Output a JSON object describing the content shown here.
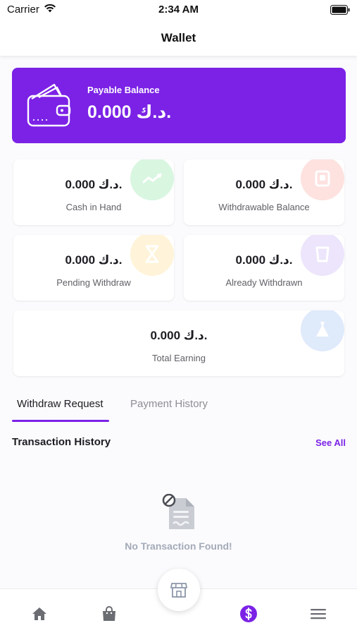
{
  "status_bar": {
    "carrier": "Carrier",
    "time": "2:34 AM"
  },
  "header": {
    "title": "Wallet"
  },
  "balance_card": {
    "label": "Payable Balance",
    "value": "0.000 د.ك."
  },
  "stats": {
    "cash_in_hand": {
      "value": "0.000 د.ك.",
      "label": "Cash in Hand"
    },
    "withdrawable_balance": {
      "value": "0.000 د.ك.",
      "label": "Withdrawable Balance"
    },
    "pending_withdraw": {
      "value": "0.000 د.ك.",
      "label": "Pending Withdraw"
    },
    "already_withdrawn": {
      "value": "0.000 د.ك.",
      "label": "Already Withdrawn"
    },
    "total_earning": {
      "value": "0.000 د.ك.",
      "label": "Total Earning"
    }
  },
  "tabs": [
    {
      "label": "Withdraw Request",
      "active": true
    },
    {
      "label": "Payment History",
      "active": false
    }
  ],
  "transactions": {
    "title": "Transaction History",
    "see_all": "See All",
    "empty_text": "No Transaction Found!"
  },
  "bottom_nav": {
    "items": [
      {
        "icon": "home-icon",
        "active": false
      },
      {
        "icon": "shopping-bag-icon",
        "active": false
      },
      {
        "icon": "store-icon",
        "active": false
      },
      {
        "icon": "dollar-icon",
        "active": true
      },
      {
        "icon": "menu-icon",
        "active": false
      }
    ]
  },
  "colors": {
    "accent": "#7b22e6",
    "cash_deco": "#d6f5de",
    "withdrawable_deco": "#fde0de",
    "pending_deco": "#fff3d6",
    "withdrawn_deco": "#ebe3fb",
    "earning_deco": "#dde9fb"
  }
}
